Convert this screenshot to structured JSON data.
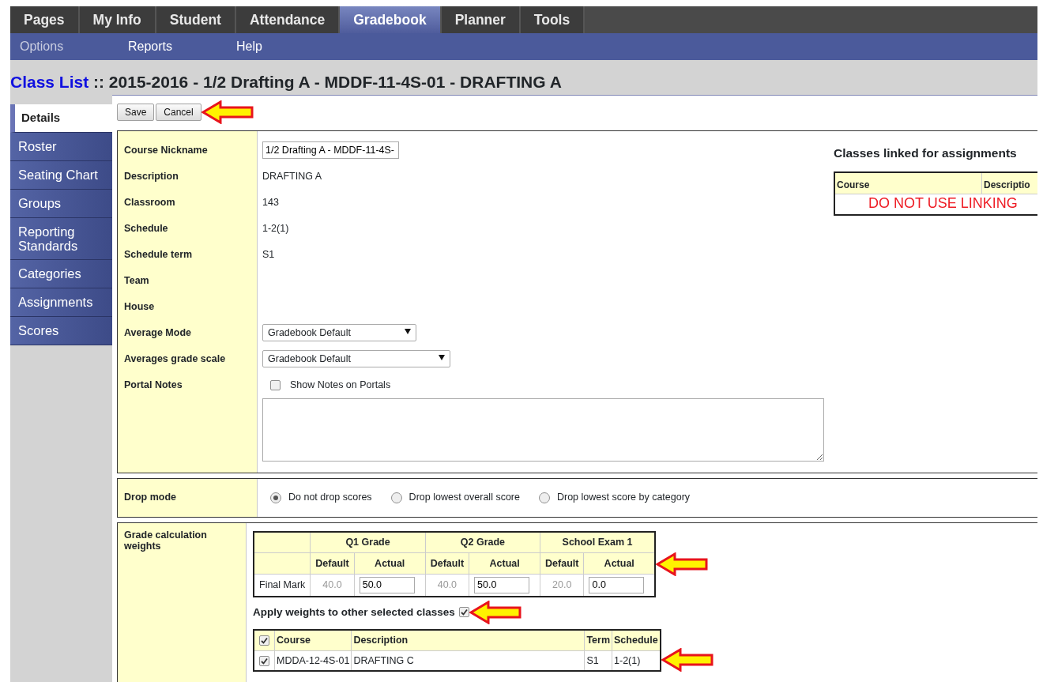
{
  "top_tabs": [
    {
      "label": "Pages",
      "selected": false
    },
    {
      "label": "My Info",
      "selected": false
    },
    {
      "label": "Student",
      "selected": false
    },
    {
      "label": "Attendance",
      "selected": false
    },
    {
      "label": "Gradebook",
      "selected": true
    },
    {
      "label": "Planner",
      "selected": false
    },
    {
      "label": "Tools",
      "selected": false
    }
  ],
  "sub_menu": [
    {
      "label": "Options",
      "selected": true
    },
    {
      "label": "Reports",
      "selected": false
    },
    {
      "label": "Help",
      "selected": false
    }
  ],
  "title": {
    "link": "Class List",
    "separator": "::",
    "text": "2015-2016 - 1/2 Drafting A - MDDF-11-4S-01 - DRAFTING A"
  },
  "side_tabs": [
    {
      "label": "Details",
      "selected": true
    },
    {
      "label": "Roster",
      "selected": false
    },
    {
      "label": "Seating Chart",
      "selected": false
    },
    {
      "label": "Groups",
      "selected": false
    },
    {
      "label": "Reporting Standards",
      "selected": false
    },
    {
      "label": "Categories",
      "selected": false
    },
    {
      "label": "Assignments",
      "selected": false
    },
    {
      "label": "Scores",
      "selected": false
    }
  ],
  "buttons": [
    "Save",
    "Cancel"
  ],
  "fields": [
    {
      "kind": "input",
      "label": "Course Nickname",
      "value": "1/2 Drafting A - MDDF-11-4S-"
    },
    {
      "kind": "text",
      "label": "Description",
      "value": "DRAFTING A"
    },
    {
      "kind": "text",
      "label": "Classroom",
      "value": "143"
    },
    {
      "kind": "text",
      "label": "Schedule",
      "value": "1-2(1)"
    },
    {
      "kind": "text",
      "label": "Schedule term",
      "value": "S1"
    },
    {
      "kind": "text",
      "label": "Team"
    },
    {
      "kind": "text",
      "label": "House"
    },
    {
      "kind": "select",
      "label": "Average Mode",
      "value": "Gradebook Default"
    },
    {
      "kind": "select",
      "label": "Averages grade scale",
      "value": "Gradebook Default"
    },
    {
      "kind": "notes",
      "label": "Portal Notes",
      "checkbox_label": "Show Notes on Portals",
      "checked": false
    }
  ],
  "linked": {
    "heading": "Classes linked for assignments",
    "columns": [
      "Course",
      "Descriptio"
    ],
    "note": "DO NOT USE LINKING"
  },
  "drop_mode": {
    "label": "Drop mode",
    "options": [
      {
        "label": "Do not drop scores",
        "selected": true
      },
      {
        "label": "Drop lowest overall score",
        "selected": false
      },
      {
        "label": "Drop lowest score by category",
        "selected": false
      }
    ]
  },
  "weights": {
    "label": "Grade calculation weights",
    "row_label": "Final Mark",
    "groups": [
      {
        "name": "Q1 Grade",
        "default_label": "Default",
        "actual_label": "Actual",
        "default": "40.0",
        "actual": "50.0"
      },
      {
        "name": "Q2 Grade",
        "default_label": "Default",
        "actual_label": "Actual",
        "default": "40.0",
        "actual": "50.0"
      },
      {
        "name": "School Exam 1",
        "default_label": "Default",
        "actual_label": "Actual",
        "default": "20.0",
        "actual": "0.0"
      }
    ],
    "apply_label": "Apply weights to other selected classes",
    "apply_checked": true,
    "classes": {
      "columns": [
        "Course",
        "Description",
        "Term",
        "Schedule"
      ],
      "all_checked": true,
      "rows": [
        {
          "checked": true,
          "course": "MDDA-12-4S-01",
          "description": "DRAFTING C",
          "term": "S1",
          "schedule": "1-2(1)"
        }
      ]
    }
  }
}
